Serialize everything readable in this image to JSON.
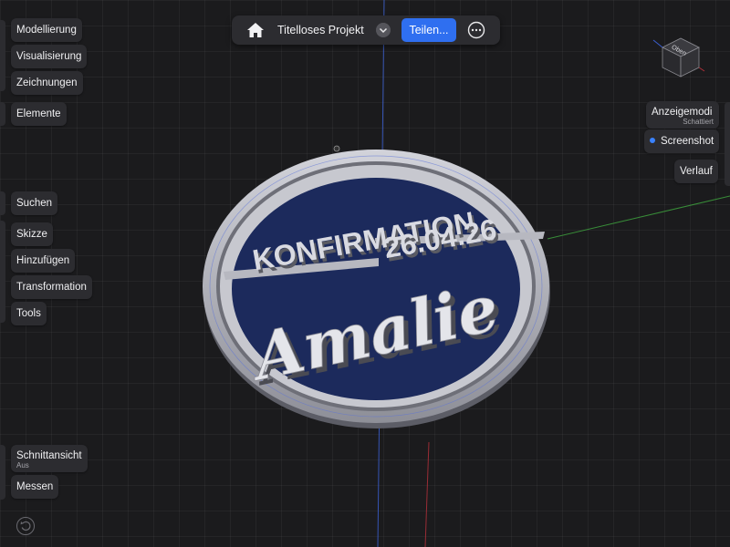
{
  "topbar": {
    "home_icon": "home-icon",
    "project_title": "Titelloses Projekt",
    "title_menu_icon": "chevron-down-icon",
    "share_label": "Teilen...",
    "more_icon": "ellipsis-icon",
    "accent": "#2f6ff0"
  },
  "left_menu": {
    "modelling": "Modellierung",
    "visualisation": "Visualisierung",
    "drawings": "Zeichnungen",
    "elements": "Elemente",
    "search": "Suchen",
    "sketch": "Skizze",
    "add": "Hinzufügen",
    "transform": "Transformation",
    "tools": "Tools",
    "section_view": "Schnittansicht",
    "section_view_state": "Aus",
    "measure": "Messen"
  },
  "right_menu": {
    "view_cube_label": "Oben",
    "display_mode": "Anzeigemodi",
    "display_mode_value": "Schattiert",
    "screenshot": "Screenshot",
    "history": "Verlauf"
  },
  "model": {
    "line1": "KONFIRMATION",
    "line2": "26.04.26",
    "name": "Amalie",
    "base_color": "#1c2a5c",
    "rim_color": "#b9bac3"
  }
}
